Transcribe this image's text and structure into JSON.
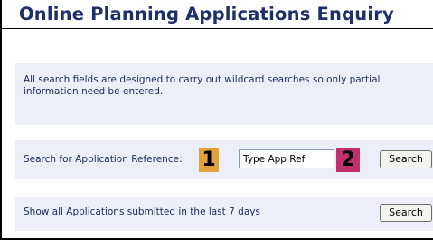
{
  "header": {
    "title": "Online Planning Applications Enquiry"
  },
  "info": {
    "text": "All search fields are designed to carry out wildcard searches so only partial information need be entered."
  },
  "reference_search": {
    "label": "Search for Application Reference:",
    "input_value": "Type App Ref",
    "button_label": "Search"
  },
  "recent_search": {
    "label": "Show all Applications submitted in the last 7 days",
    "button_label": "Search"
  },
  "markers": {
    "first": "1",
    "second": "2",
    "first_color": "#e2a33c",
    "second_color": "#c0306c"
  },
  "colors": {
    "title": "#1e2f6b",
    "panel_background": "#eceff8"
  }
}
